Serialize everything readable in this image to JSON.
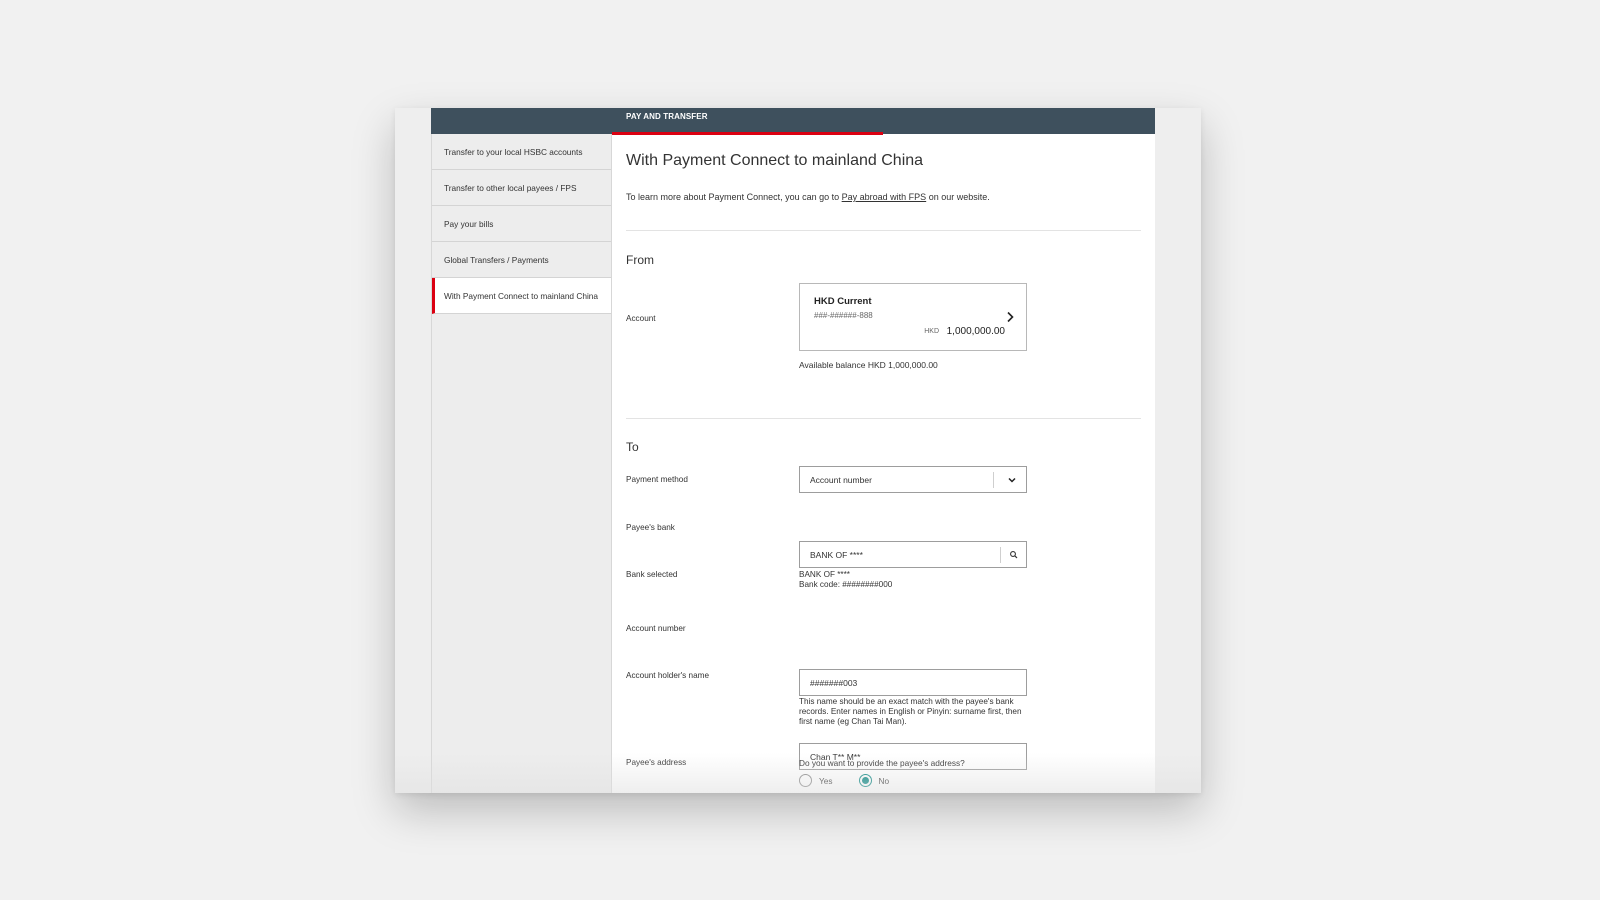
{
  "header": {
    "title": "PAY AND TRANSFER"
  },
  "sidebar": {
    "items": [
      {
        "label": "Transfer to your local HSBC accounts"
      },
      {
        "label": "Transfer to other local payees / FPS"
      },
      {
        "label": "Pay your bills"
      },
      {
        "label": "Global Transfers / Payments"
      },
      {
        "label": "With Payment Connect to mainland China"
      }
    ]
  },
  "main": {
    "title": "With Payment Connect to mainland China",
    "intro_prefix": "To learn more about Payment Connect, you can go to ",
    "intro_link": "Pay abroad with FPS",
    "intro_suffix": " on our website.",
    "from": {
      "section_title": "From",
      "account_label": "Account",
      "account_name": "HKD Current",
      "account_number": "###-######-888",
      "currency": "HKD",
      "balance": "1,000,000.00",
      "available_balance": "Available balance HKD 1,000,000.00"
    },
    "to": {
      "section_title": "To",
      "payment_method_label": "Payment method",
      "payment_method_value": "Account number",
      "payee_bank_label": "Payee's bank",
      "payee_bank_value": "BANK OF ****",
      "bank_selected_label": "Bank selected",
      "bank_selected_name": "BANK OF ****",
      "bank_selected_code": "Bank code: ########000",
      "account_number_label": "Account number",
      "account_number_value": "#######003",
      "holder_label": "Account holder's name",
      "holder_value": "Chan T** M**",
      "holder_hint": "This name should be an exact match with the payee's bank records. Enter names in English or Pinyin: surname first, then first name (eg Chan Tai Man).",
      "address_label": "Payee's address",
      "address_question": "Do you want to provide the payee's address?",
      "address_options": [
        "Yes",
        "No"
      ],
      "address_selected": "No"
    }
  },
  "colors": {
    "topbar": "#3e505d",
    "accent_red": "#db0011",
    "radio_selected": "#00847f"
  }
}
